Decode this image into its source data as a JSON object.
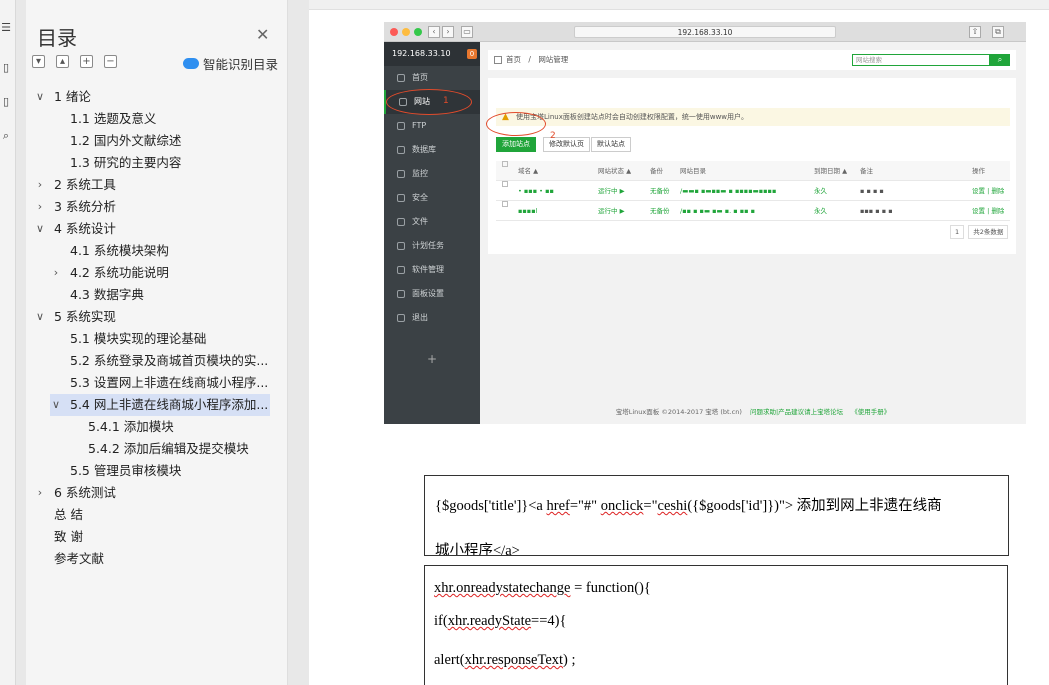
{
  "toc": {
    "title": "目录",
    "close_icon": "close-icon",
    "toolbar_buttons": [
      "collapse-icon",
      "expand-up-icon",
      "plus-icon",
      "minus-icon"
    ],
    "smart_label": "智能识别目录",
    "items": [
      {
        "label": "1  绪论",
        "level": 0,
        "expand": "open"
      },
      {
        "label": "1.1  选题及意义",
        "level": 1,
        "expand": "none"
      },
      {
        "label": "1.2  国内外文献综述",
        "level": 1,
        "expand": "none"
      },
      {
        "label": "1.3  研究的主要内容",
        "level": 1,
        "expand": "none"
      },
      {
        "label": "2  系统工具",
        "level": 0,
        "expand": "closed"
      },
      {
        "label": "3  系统分析",
        "level": 0,
        "expand": "closed"
      },
      {
        "label": "4  系统设计",
        "level": 0,
        "expand": "open"
      },
      {
        "label": "4.1  系统模块架构",
        "level": 1,
        "expand": "none"
      },
      {
        "label": "4.2  系统功能说明",
        "level": 1,
        "expand": "closed"
      },
      {
        "label": "4.3  数据字典",
        "level": 1,
        "expand": "none"
      },
      {
        "label": "5  系统实现",
        "level": 0,
        "expand": "open"
      },
      {
        "label": "5.1  模块实现的理论基础",
        "level": 1,
        "expand": "none"
      },
      {
        "label": "5.2  系统登录及商城首页模块的实...",
        "level": 1,
        "expand": "none"
      },
      {
        "label": "5.3  设置网上非遗在线商城小程序...",
        "level": 1,
        "expand": "none"
      },
      {
        "label": "5.4  网上非遗在线商城小程序添加...",
        "level": 1,
        "expand": "open",
        "active": true
      },
      {
        "label": "5.4.1  添加模块",
        "level": 2,
        "expand": "none"
      },
      {
        "label": "5.4.2  添加后编辑及提交模块",
        "level": 2,
        "expand": "none"
      },
      {
        "label": "5.5  管理员审核模块",
        "level": 1,
        "expand": "none"
      },
      {
        "label": "6  系统测试",
        "level": 0,
        "expand": "closed"
      },
      {
        "label": "总   结",
        "level": 0,
        "expand": "none"
      },
      {
        "label": "致   谢",
        "level": 0,
        "expand": "none"
      },
      {
        "label": "参考文献",
        "level": 0,
        "expand": "none"
      }
    ]
  },
  "screenshot": {
    "url": "192.168.33.10",
    "host": "192.168.33.10",
    "host_badge": "0",
    "side_items": [
      "首页",
      "网站",
      "FTP",
      "数据库",
      "监控",
      "安全",
      "文件",
      "计划任务",
      "软件管理",
      "面板设置",
      "退出"
    ],
    "selected_side": 1,
    "side_plus": "+",
    "breadcrumb": [
      "首页",
      "/",
      "网站管理"
    ],
    "search_placeholder": "网站搜索",
    "warning": "使用宝塔Linux面板创建站点时会自动创建权限配置，统一使用www用户。",
    "buttons": {
      "add": "添加站点",
      "default_page": "修改默认页",
      "default_site": "默认站点"
    },
    "columns": [
      "域名 ▲",
      "网站状态 ▲",
      "备份",
      "网站目录",
      "到期日期 ▲",
      "备注",
      "操作"
    ],
    "rows": [
      {
        "domain": "• ▪▪▪ • ▪▪",
        "status": "运行中 ▶",
        "backup": "无备份",
        "dir": "/▬▬▪ ▪▬▪▪▬ ▪ ▪▪▪▪▬▪▪▪▪",
        "expire": "永久",
        "note": "▪ ▪ ▪ ▪",
        "ops": "设置 | 删除"
      },
      {
        "domain": "▪▪▪▪l",
        "status": "运行中 ▶",
        "backup": "无备份",
        "dir": "/▪▪ ▪ ▪▬ ▪▬ ▪. ▪ ▪▪ ▪",
        "expire": "永久",
        "note": "▪▪▪ ▪ ▪ ▪",
        "ops": "设置 | 删除"
      }
    ],
    "pager": {
      "page": "1",
      "total": "共2条数据"
    },
    "footer": {
      "copyright": "宝塔Linux面板 ©2014-2017 宝塔 (bt.cn)",
      "link1": "问题求助|产品建议请上宝塔论坛",
      "link2": "《使用手册》"
    },
    "annotations": [
      "1",
      "2"
    ]
  },
  "code1": {
    "line1": "{$goods['title']}<a href=\"#\" onclick=\"ceshi({$goods['id']})\">  添加到网上非遗在线商",
    "line2": "城小程序</a>"
  },
  "code2": {
    "lines": [
      "xhr.onreadystatechange = function(){",
      "if(xhr.readyState==4){",
      "alert(xhr.responseText) ;"
    ]
  },
  "colors": {
    "accent": "#20a53a",
    "annotation": "#e24b2b",
    "sidebar": "#3b4145",
    "toc_active": "#d6e0f5"
  }
}
